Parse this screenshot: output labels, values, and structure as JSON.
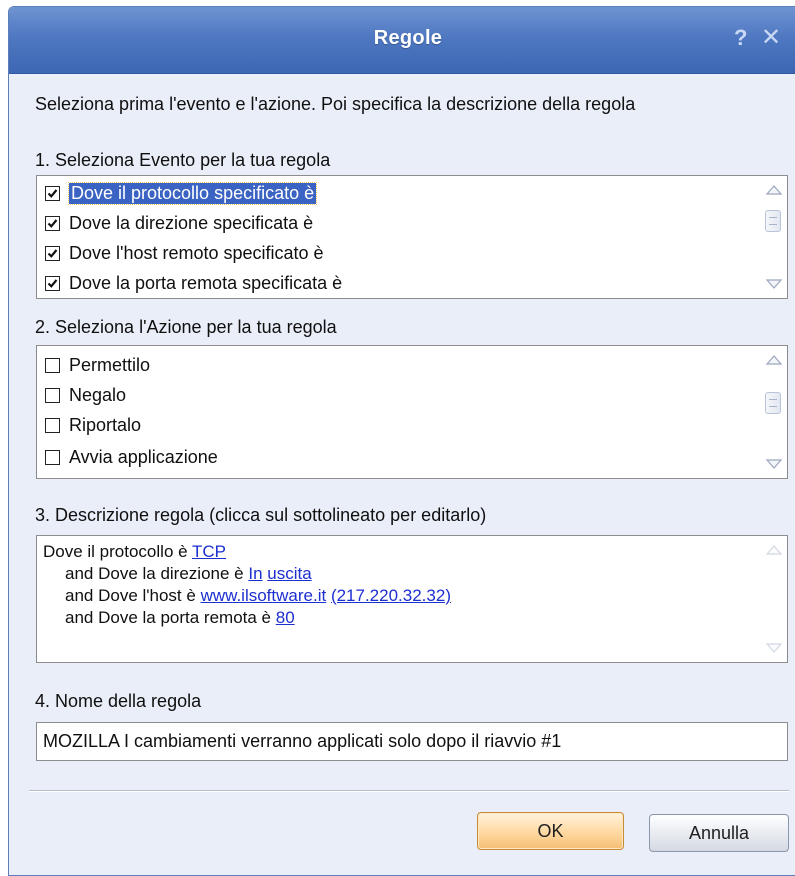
{
  "window": {
    "title": "Regole",
    "help_glyph": "?",
    "close_glyph": "✕"
  },
  "intro": "Seleziona prima l'evento e l'azione. Poi specifica la descrizione della regola",
  "events": {
    "label": "1. Seleziona Evento per la tua regola",
    "items": [
      {
        "label": "Dove il protocollo specificato è",
        "checked": true,
        "selected": true
      },
      {
        "label": "Dove la direzione specificata è",
        "checked": true,
        "selected": false
      },
      {
        "label": "Dove l'host remoto specificato è",
        "checked": true,
        "selected": false
      },
      {
        "label": "Dove la porta remota specificata è",
        "checked": true,
        "selected": false
      }
    ]
  },
  "actions": {
    "label": "2. Seleziona l'Azione per la tua regola",
    "items": [
      {
        "label": "Permettilo",
        "checked": false
      },
      {
        "label": "Negalo",
        "checked": false
      },
      {
        "label": "Riportalo",
        "checked": false
      },
      {
        "label": "Avvia applicazione",
        "checked": false
      }
    ]
  },
  "description": {
    "label": "3. Descrizione regola (clicca sul sottolineato per editarlo)",
    "line1_prefix": "Dove il protocollo è ",
    "line1_link": "TCP",
    "line2_prefix": "and Dove la direzione è ",
    "line2_link_a": "In",
    "line2_link_b": "uscita",
    "line3_prefix": "and Dove l'host è ",
    "line3_link_a": "www.ilsoftware.it",
    "line3_link_b": "(217.220.32.32)",
    "line4_prefix": "and Dove la porta remota è ",
    "line4_link": "80"
  },
  "rule_name": {
    "label": "4. Nome della regola",
    "value": "MOZILLA I cambiamenti verranno applicati solo dopo il riavvio #1"
  },
  "buttons": {
    "ok": "OK",
    "cancel": "Annulla"
  },
  "colors": {
    "title_bar": "#4f78c2",
    "selection": "#3a63c4",
    "link": "#1c2fcf",
    "ok_button": "#ffd9a0"
  }
}
